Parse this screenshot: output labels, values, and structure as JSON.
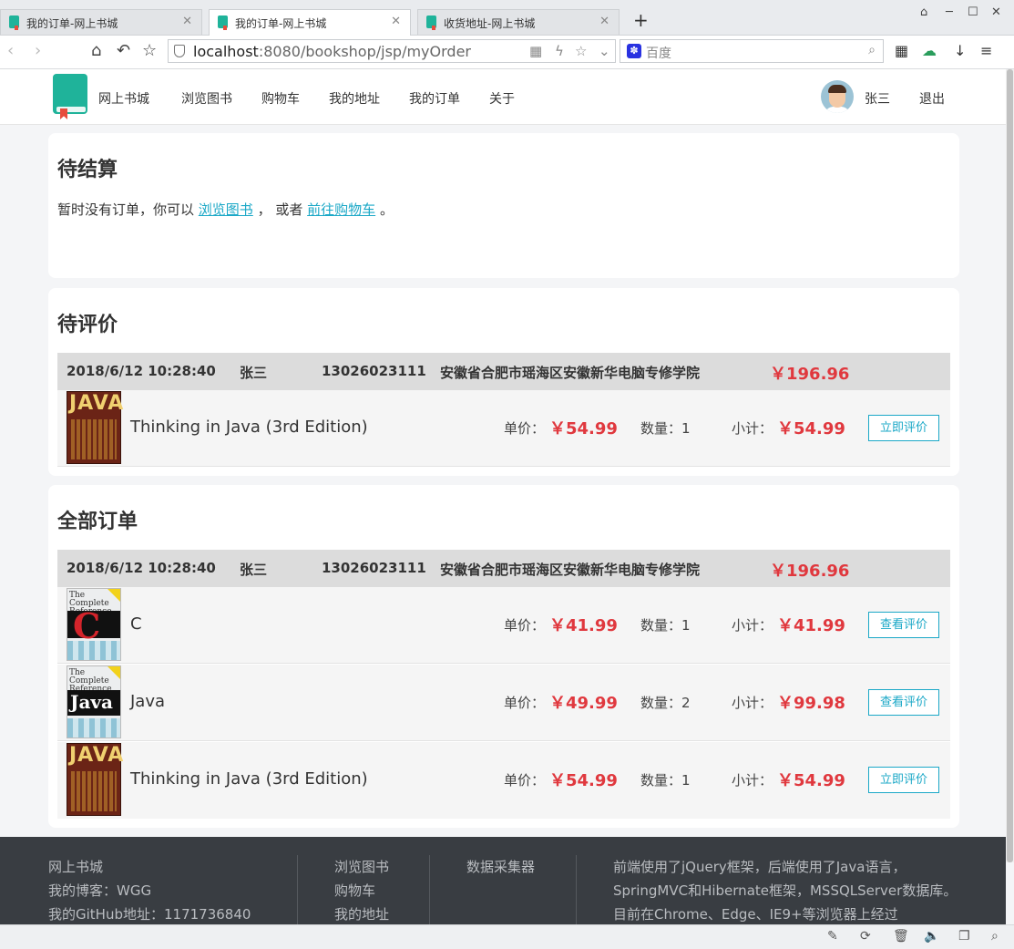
{
  "browser": {
    "tabs": [
      {
        "title": "我的订单-网上书城"
      },
      {
        "title": "我的订单-网上书城"
      },
      {
        "title": "收货地址-网上书城"
      }
    ],
    "url_host": "localhost",
    "url_rest": ":8080/bookshop/jsp/myOrder",
    "search_placeholder": "百度"
  },
  "header": {
    "brand": "网上书城",
    "nav": [
      "浏览图书",
      "购物车",
      "我的地址",
      "我的订单",
      "关于"
    ],
    "username": "张三",
    "logout": "退出"
  },
  "pending": {
    "title": "待结算",
    "empty_prefix": "暂时没有订单，你可以",
    "link_browse": "浏览图书",
    "empty_mid": "， 或者",
    "link_cart": "前往购物车",
    "empty_suffix": "。"
  },
  "toReview": {
    "title": "待评价",
    "order": {
      "date": "2018/6/12 10:28:40",
      "name": "张三",
      "phone": "13026023111",
      "address": "安徽省合肥市瑶海区安徽新华电脑专修学院",
      "total": "￥196.96"
    },
    "items": [
      {
        "title": "Thinking in Java (3rd Edition)",
        "unit_label": "单价：",
        "unit": "￥54.99",
        "qty_label": "数量：1",
        "sub_label": "小计：",
        "subtotal": "￥54.99",
        "action": "立即评价",
        "cover": "java3"
      }
    ]
  },
  "allOrders": {
    "title": "全部订单",
    "order": {
      "date": "2018/6/12 10:28:40",
      "name": "张三",
      "phone": "13026023111",
      "address": "安徽省合肥市瑶海区安徽新华电脑专修学院",
      "total": "￥196.96"
    },
    "items": [
      {
        "title": "C",
        "unit_label": "单价：",
        "unit": "￥41.99",
        "qty_label": "数量：1",
        "sub_label": "小计：",
        "subtotal": "￥41.99",
        "action": "查看评价",
        "cover": "c"
      },
      {
        "title": "Java",
        "unit_label": "单价：",
        "unit": "￥49.99",
        "qty_label": "数量：2",
        "sub_label": "小计：",
        "subtotal": "￥99.98",
        "action": "查看评价",
        "cover": "java"
      },
      {
        "title": "Thinking in Java (3rd Edition)",
        "unit_label": "单价：",
        "unit": "￥54.99",
        "qty_label": "数量：1",
        "sub_label": "小计：",
        "subtotal": "￥54.99",
        "action": "立即评价",
        "cover": "java3"
      }
    ]
  },
  "covers": {
    "java3_text": "JAVA",
    "complete_ref": "The Complete Reference",
    "c_letter": "C",
    "java_word": "Java"
  },
  "footer": {
    "col1": [
      "网上书城",
      "我的博客：WGG",
      "我的GitHub地址：1171736840"
    ],
    "col2": [
      "浏览图书",
      "购物车",
      "我的地址"
    ],
    "col3": [
      "数据采集器"
    ],
    "col4": "前端使用了jQuery框架，后端使用了Java语言，SpringMVC和Hibernate框架，MSSQLServer数据库。 目前在Chrome、Edge、IE9+等浏览器上经过"
  }
}
